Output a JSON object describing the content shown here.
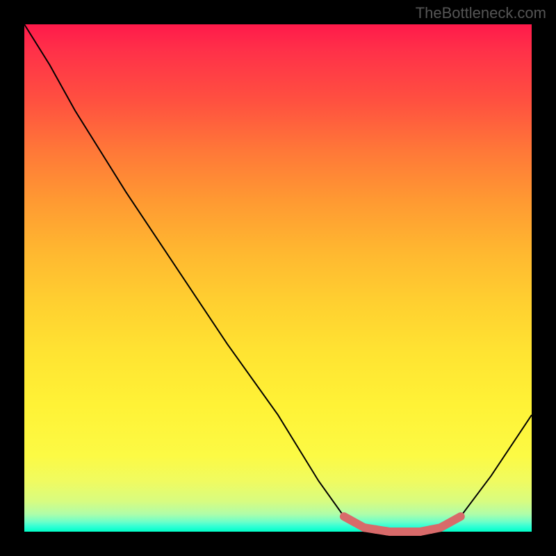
{
  "watermark": "TheBottleneck.com",
  "chart_data": {
    "type": "line",
    "title": "",
    "xlabel": "",
    "ylabel": "",
    "xlim": [
      0,
      100
    ],
    "ylim": [
      0,
      100
    ],
    "curve": [
      {
        "x": 0,
        "y": 100
      },
      {
        "x": 5,
        "y": 92
      },
      {
        "x": 10,
        "y": 83
      },
      {
        "x": 20,
        "y": 67
      },
      {
        "x": 30,
        "y": 52
      },
      {
        "x": 40,
        "y": 37
      },
      {
        "x": 50,
        "y": 23
      },
      {
        "x": 58,
        "y": 10
      },
      {
        "x": 63,
        "y": 3
      },
      {
        "x": 67,
        "y": 0.8
      },
      {
        "x": 72,
        "y": 0
      },
      {
        "x": 78,
        "y": 0
      },
      {
        "x": 82,
        "y": 0.8
      },
      {
        "x": 86,
        "y": 3
      },
      {
        "x": 92,
        "y": 11
      },
      {
        "x": 100,
        "y": 23
      }
    ],
    "highlight_region": {
      "x_start": 63,
      "x_end": 86
    },
    "gradient": {
      "top_color": "#ff1a4a",
      "bottom_color": "#00ffc8",
      "meaning": "bottleneck-severity"
    }
  }
}
